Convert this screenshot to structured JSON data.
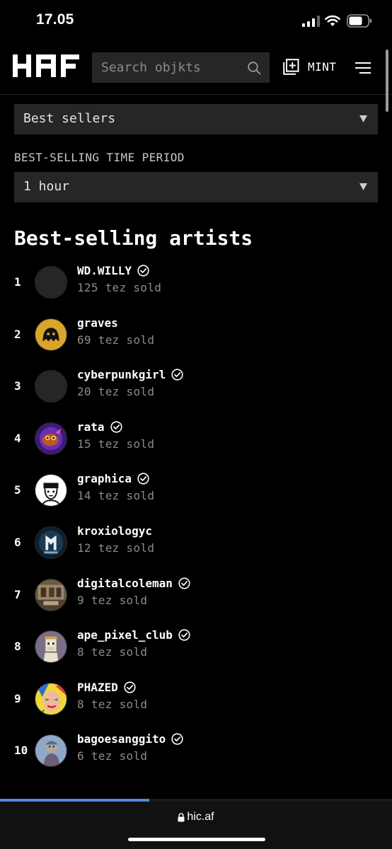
{
  "status_bar": {
    "time": "17.05",
    "icons": [
      "cellular-signal-icon",
      "wifi-icon",
      "battery-icon"
    ]
  },
  "header": {
    "logo_text": "HAF",
    "search": {
      "placeholder": "Search objkts",
      "value": ""
    },
    "mint_label": "MINT",
    "icons": {
      "search": "search-icon",
      "mint": "plus-square-icon",
      "menu": "hamburger-menu-icon"
    }
  },
  "filters": {
    "sort_select": {
      "value": "Best sellers"
    },
    "period_label": "BEST-SELLING TIME PERIOD",
    "period_select": {
      "value": "1 hour"
    }
  },
  "page_title": "Best-selling artists",
  "artists": [
    {
      "rank": "1",
      "name": "WD.WILLY",
      "sold": "125 tez sold",
      "verified": true,
      "avatar": "dark-blank"
    },
    {
      "rank": "2",
      "name": "graves",
      "sold": "69 tez sold",
      "verified": false,
      "avatar": "yellow-creature"
    },
    {
      "rank": "3",
      "name": "cyberpunkgirl",
      "sold": "20 tez sold",
      "verified": true,
      "avatar": "dark-blank"
    },
    {
      "rank": "4",
      "name": "rata",
      "sold": "15 tez sold",
      "verified": true,
      "avatar": "purple-character"
    },
    {
      "rank": "5",
      "name": "graphica",
      "sold": "14 tez sold",
      "verified": true,
      "avatar": "white-face-sketch"
    },
    {
      "rank": "6",
      "name": "kroxiologyc",
      "sold": "12 tez sold",
      "verified": false,
      "avatar": "dark-blue-emblem"
    },
    {
      "rank": "7",
      "name": "digitalcoleman",
      "sold": "9 tez sold",
      "verified": true,
      "avatar": "sepia-room"
    },
    {
      "rank": "8",
      "name": "ape_pixel_club",
      "sold": "8 tez sold",
      "verified": true,
      "avatar": "pixel-ape"
    },
    {
      "rank": "9",
      "name": "PHAZED",
      "sold": "8 tez sold",
      "verified": true,
      "avatar": "colorful-face"
    },
    {
      "rank": "10",
      "name": "bagoesanggito",
      "sold": "6 tez sold",
      "verified": true,
      "avatar": "blue-figure"
    }
  ],
  "browser": {
    "url": "hic.af",
    "load_progress": 0.38
  },
  "colors": {
    "background": "#000000",
    "input_background": "#262626",
    "secondary_text": "#8c8c8c",
    "progress_blue": "#5a84d8"
  }
}
